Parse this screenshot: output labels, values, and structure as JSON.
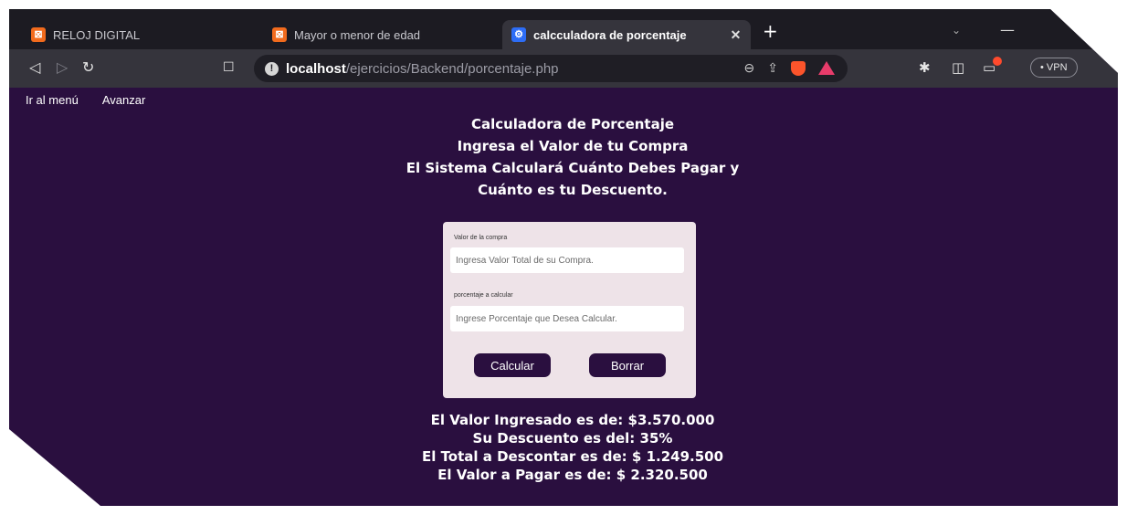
{
  "browser": {
    "tabs": [
      {
        "title": "RELOJ DIGITAL",
        "active": false
      },
      {
        "title": "Mayor o menor de edad",
        "active": false
      },
      {
        "title": "calcculadora de porcentaje",
        "active": true
      }
    ],
    "url_host": "localhost",
    "url_path": "/ejercicios/Backend/porcentaje.php",
    "vpn_label": "• VPN"
  },
  "page": {
    "nav": {
      "menu": "Ir al menú",
      "next": "Avanzar"
    },
    "heading_lines": [
      "Calculadora de Porcentaje",
      "Ingresa el Valor de tu Compra",
      "El Sistema Calculará Cuánto Debes Pagar y",
      "Cuánto es tu Descuento."
    ],
    "form": {
      "amount_label": "Valor de la compra",
      "amount_placeholder": "Ingresa Valor Total de su Compra.",
      "percent_label": "porcentaje a calcular",
      "percent_placeholder": "Ingrese Porcentaje que Desea Calcular.",
      "calc_button": "Calcular",
      "clear_button": "Borrar"
    },
    "results": [
      "El Valor Ingresado es de: $3.570.000",
      "Su Descuento es del: 35%",
      "El Total a Descontar es de: $ 1.249.500",
      "El Valor a Pagar es de: $ 2.320.500"
    ]
  },
  "colors": {
    "page_background": "#2a0f3f",
    "card_background": "#eee3e8",
    "button_background": "#2a0f3f"
  }
}
